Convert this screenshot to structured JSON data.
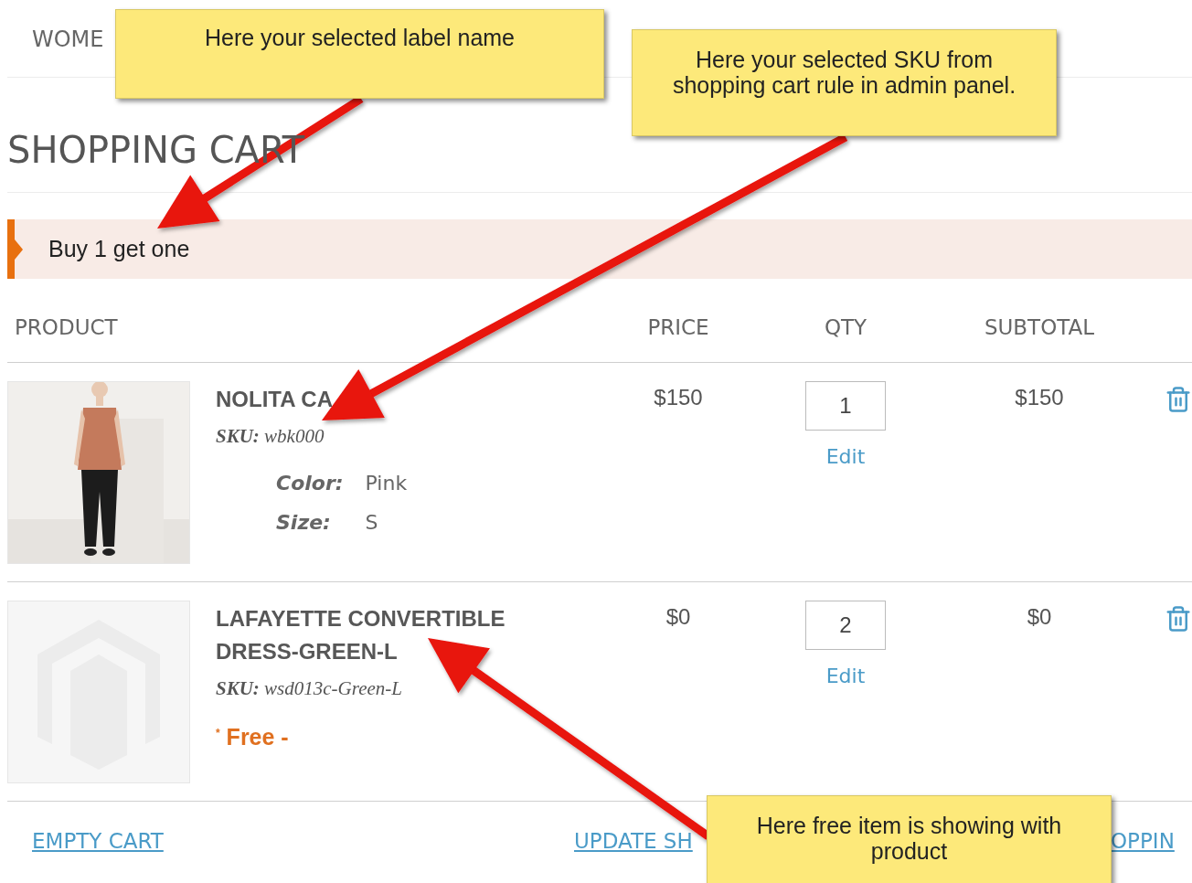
{
  "nav": {
    "items": [
      {
        "label": "WOME"
      }
    ]
  },
  "title": "SHOPPING CART",
  "rule_label": "Buy 1 get one",
  "columns": [
    "PRODUCT",
    "PRICE",
    "QTY",
    "SUBTOTAL"
  ],
  "items": [
    {
      "name": "NOLITA CA",
      "sku": "**SKU:** wbk000",
      "options": [
        {
          "label": "Color:",
          "value": "Pink"
        },
        {
          "label": "Size:",
          "value": "S"
        }
      ],
      "price": "$150",
      "qty": "1",
      "edit": "Edit",
      "subtotal": "$150"
    },
    {
      "kind": "placeholder",
      "name": "LAFAYETTE CONVERTIBLE DRESS-GREEN-L",
      "sku": "**SKU:** wsd013c-Green-L",
      "note": "$^{*}$ Free -",
      "price": "$0",
      "qty": "2",
      "edit": "Edit",
      "subtotal": "$0"
    }
  ],
  "actions": [
    "EMPTY CART",
    "UPDATE SH",
    "OPPIN"
  ],
  "callouts": [
    {
      "text": "Here your selected label name"
    },
    {
      "text": "Here your selected SKU from shopping cart rule in admin panel."
    },
    {
      "text": "Here free item is showing with product"
    }
  ]
}
